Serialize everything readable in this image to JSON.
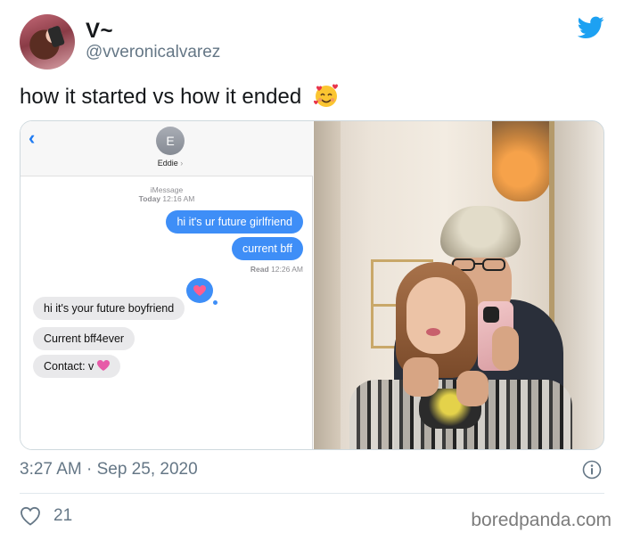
{
  "user": {
    "display_name": "V~",
    "handle": "@vveronicalvarez"
  },
  "icons": {
    "brand": "twitter-bird-icon",
    "emoji": "smiling-face-with-hearts-emoji",
    "info": "info-icon",
    "like": "heart-outline-icon",
    "back": "chevron-left-icon",
    "tapback": "heart-tapback-icon"
  },
  "colors": {
    "twitter_blue": "#1da1f2",
    "imessage_blue": "#3e8ef7",
    "gray_text": "#657786"
  },
  "tweet": {
    "text": "how it started vs how it ended"
  },
  "imessage": {
    "back_glyph": "‹",
    "contact_initial": "E",
    "contact_name": "Eddie",
    "contact_chevron": "›",
    "service": "iMessage",
    "today_label": "Today",
    "today_time": "12:16 AM",
    "outgoing": [
      "hi it's ur future girlfriend",
      "current bff"
    ],
    "read_label": "Read",
    "read_time": "12:26 AM",
    "incoming": [
      "hi it's your future boyfriend",
      "Current bff4ever",
      "Contact: v"
    ]
  },
  "footer": {
    "timestamp": "3:27 AM · Sep 25, 2020",
    "likes": "21",
    "watermark": "boredpanda.com"
  }
}
